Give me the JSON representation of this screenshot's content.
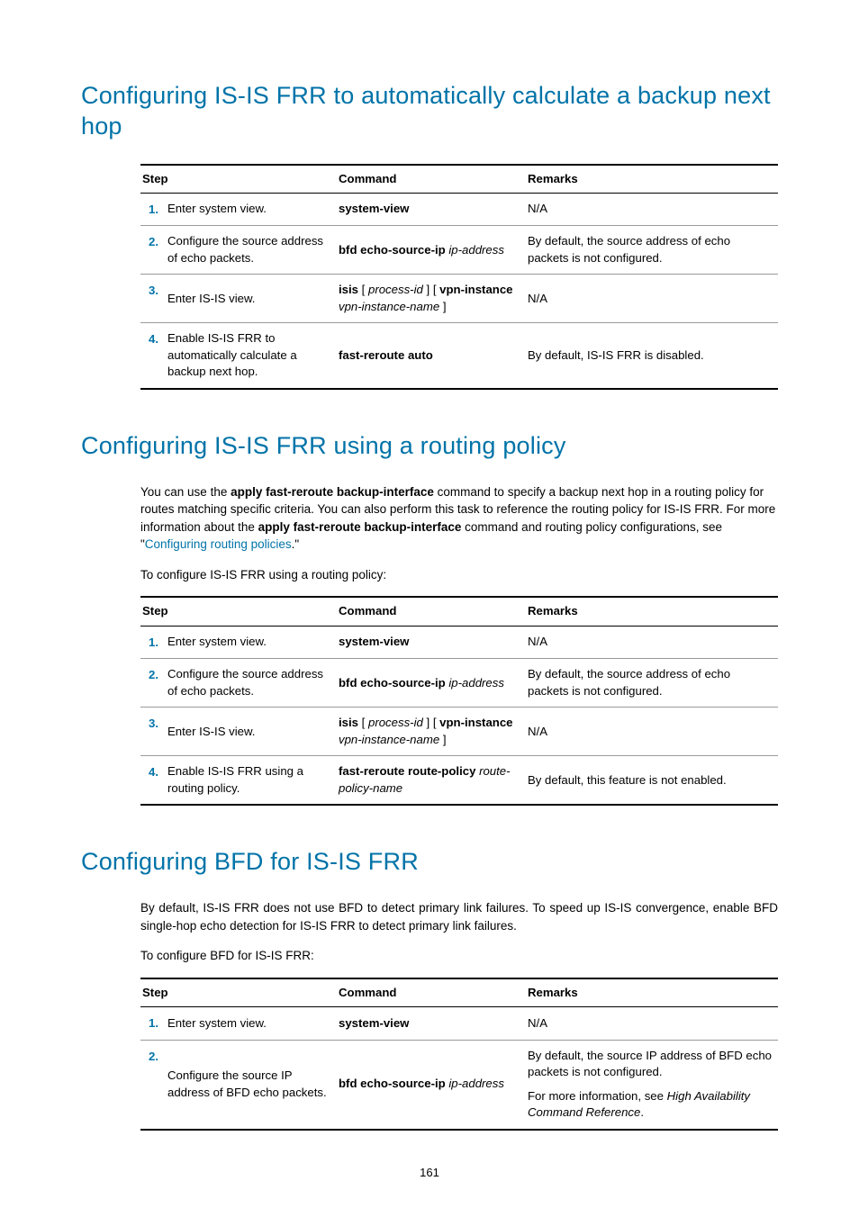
{
  "section1": {
    "title": "Configuring IS-IS FRR to automatically calculate a backup next hop",
    "table": {
      "headers": {
        "step": "Step",
        "command": "Command",
        "remarks": "Remarks"
      },
      "rows": [
        {
          "num": "1.",
          "desc": "Enter system view.",
          "cmd_bold": "system-view",
          "cmd_italic": "",
          "remarks": "N/A"
        },
        {
          "num": "2.",
          "desc": "Configure the source address of echo packets.",
          "cmd_bold": "bfd echo-source-ip",
          "cmd_italic": " ip-address",
          "remarks": "By default, the source address of echo packets is not configured."
        },
        {
          "num": "3.",
          "desc": "Enter IS-IS view.",
          "cmd_html": "isis_cmd",
          "remarks": "N/A"
        },
        {
          "num": "4.",
          "desc": "Enable IS-IS FRR to automatically calculate a backup next hop.",
          "cmd_bold": "fast-reroute auto",
          "cmd_italic": "",
          "remarks": "By default, IS-IS FRR is disabled."
        }
      ]
    }
  },
  "isis_cmd": {
    "b1": "isis",
    "t1": " [ ",
    "i1": "process-id",
    "t2": " ] [ ",
    "b2": "vpn-instance",
    "t3": " ",
    "i2": "vpn-instance-name",
    "t4": " ]"
  },
  "section2": {
    "title": "Configuring IS-IS FRR using a routing policy",
    "para1_pre": "You can use the ",
    "para1_bold1": "apply fast-reroute backup-interface",
    "para1_mid1": " command to specify a backup next hop in a routing policy for routes matching specific criteria. You can also perform this task to reference the routing policy for IS-IS FRR. For more information about the ",
    "para1_bold2": "apply fast-reroute backup-interface",
    "para1_mid2": " command and routing policy configurations, see \"",
    "para1_link": "Configuring routing policies",
    "para1_post": ".\"",
    "para2": "To configure IS-IS FRR using a routing policy:",
    "table": {
      "headers": {
        "step": "Step",
        "command": "Command",
        "remarks": "Remarks"
      },
      "rows": [
        {
          "num": "1.",
          "desc": "Enter system view.",
          "cmd_bold": "system-view",
          "cmd_italic": "",
          "remarks": "N/A"
        },
        {
          "num": "2.",
          "desc": "Configure the source address of echo packets.",
          "cmd_bold": "bfd echo-source-ip",
          "cmd_italic": " ip-address",
          "remarks": "By default, the source address of echo packets is not configured."
        },
        {
          "num": "3.",
          "desc": "Enter IS-IS view.",
          "cmd_html": "isis_cmd",
          "remarks": "N/A"
        },
        {
          "num": "4.",
          "desc": "Enable IS-IS FRR using a routing policy.",
          "cmd_bold": "fast-reroute route-policy",
          "cmd_italic": " route-policy-name",
          "remarks": "By default, this feature is not enabled."
        }
      ]
    }
  },
  "section3": {
    "title": "Configuring BFD for IS-IS FRR",
    "para1": "By default, IS-IS FRR does not use BFD to detect primary link failures. To speed up IS-IS convergence, enable BFD single-hop echo detection for IS-IS FRR to detect primary link failures.",
    "para2": "To configure BFD for IS-IS FRR:",
    "table": {
      "headers": {
        "step": "Step",
        "command": "Command",
        "remarks": "Remarks"
      },
      "rows": [
        {
          "num": "1.",
          "desc": "Enter system view.",
          "cmd_bold": "system-view",
          "cmd_italic": "",
          "remarks": "N/A"
        },
        {
          "num": "2.",
          "desc": "Configure the source IP address of BFD echo packets.",
          "cmd_bold": "bfd echo-source-ip",
          "cmd_italic": " ip-address",
          "remarks_p1": "By default, the source IP address of BFD echo packets is not configured.",
          "remarks_p2_pre": "For more information, see ",
          "remarks_p2_italic": "High Availability Command Reference",
          "remarks_p2_post": "."
        }
      ]
    }
  },
  "page_number": "161"
}
